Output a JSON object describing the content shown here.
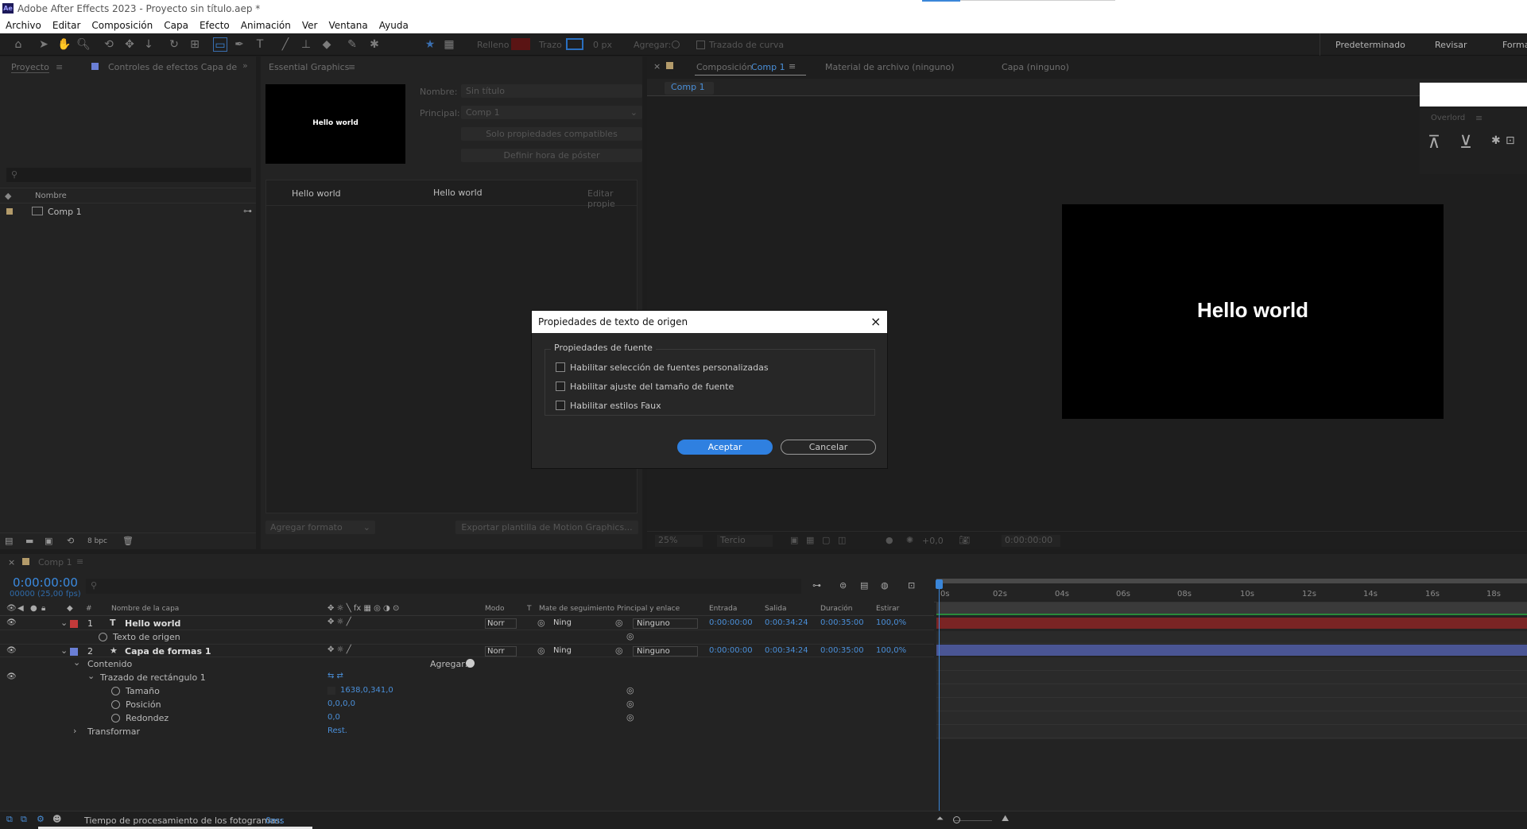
{
  "window": {
    "title": "Adobe After Effects 2023 - Proyecto sin título.aep *",
    "app_badge": "Ae"
  },
  "menu": [
    "Archivo",
    "Editar",
    "Composición",
    "Capa",
    "Efecto",
    "Animación",
    "Ver",
    "Ventana",
    "Ayuda"
  ],
  "toolbar": {
    "fill_label": "Relleno",
    "stroke_label": "Trazo",
    "stroke_width": "0 px",
    "add_label": "Agregar:",
    "bezier_label": "Trazado de curva",
    "workspaces": [
      "Predeterminado",
      "Revisar",
      "Forma"
    ]
  },
  "project_panel": {
    "tab_project": "Proyecto",
    "tab_effects": "Controles de efectos Capa de",
    "column_name": "Nombre",
    "items": [
      {
        "name": "Comp 1"
      }
    ],
    "bpc": "8 bpc"
  },
  "essential_graphics": {
    "tab": "Essential Graphics",
    "preview_text": "Hello world",
    "name_label": "Nombre:",
    "name_placeholder": "Sin título",
    "principal_label": "Principal:",
    "principal_value": "Comp 1",
    "compatible_button": "Solo propiedades compatibles",
    "poster_button": "Definir hora de póster",
    "rows": [
      {
        "label": "Hello world",
        "value": "Hello world"
      }
    ],
    "edit_props": "Editar propie",
    "add_format": "Agregar formato",
    "export_button": "Exportar plantilla de Motion Graphics..."
  },
  "viewer": {
    "tab_comp_prefix": "Composición",
    "tab_comp_name": "Comp 1",
    "tab_footage": "Material de archivo (ninguno)",
    "tab_layer": "Capa (ninguno)",
    "sub_tab": "Comp 1",
    "canvas_text": "Hello world",
    "zoom": "25%",
    "resolution": "Tercio",
    "exposure": "+0,0",
    "timecode": "0:00:00:00"
  },
  "overlord": {
    "title": "Overlord"
  },
  "dialog": {
    "title": "Propiedades de texto de origen",
    "group": "Propiedades de fuente",
    "options": [
      "Habilitar selección de fuentes personalizadas",
      "Habilitar ajuste del tamaño de fuente",
      "Habilitar estilos Faux"
    ],
    "ok": "Aceptar",
    "cancel": "Cancelar"
  },
  "timeline": {
    "tab": "Comp 1",
    "timecode": "0:00:00:00",
    "frames": "00000 (25,00 fps)",
    "columns": {
      "num": "#",
      "layer_name": "Nombre de la capa",
      "mode": "Modo",
      "t": "T",
      "matte": "Mate de seguimiento",
      "parent": "Principal y enlace",
      "in": "Entrada",
      "out": "Salida",
      "duration": "Duración",
      "stretch": "Estirar"
    },
    "layers": [
      {
        "num": "1",
        "name": "Hello world",
        "mode": "Norr",
        "matte": "Ning",
        "parent": "Ninguno",
        "in": "0:00:00:00",
        "out": "0:00:34:24",
        "duration": "0:00:35:00",
        "stretch": "100,0%",
        "color": "#c23a3a",
        "type": "T"
      },
      {
        "num": "2",
        "name": "Capa de formas 1",
        "mode": "Norr",
        "matte": "Ning",
        "parent": "Ninguno",
        "in": "0:00:00:00",
        "out": "0:00:34:24",
        "duration": "0:00:35:00",
        "stretch": "100,0%",
        "color": "#6a7fd6",
        "type": "★"
      }
    ],
    "source_text": "Texto de origen",
    "contents": "Contenido",
    "add": "Agregar:",
    "rect_path": "Trazado de rectángulo 1",
    "size_label": "Tamaño",
    "size_value": "1638,0,341,0",
    "position_label": "Posición",
    "position_value": "0,0,0,0",
    "roundness_label": "Redondez",
    "roundness_value": "0,0",
    "transform": "Transformar",
    "transform_value": "Rest.",
    "ruler": [
      "0s",
      "02s",
      "04s",
      "06s",
      "08s",
      "10s",
      "12s",
      "14s",
      "16s",
      "18s"
    ],
    "render_time_label": "Tiempo de procesamiento de los fotogramas:",
    "render_time_value": "0ms"
  }
}
